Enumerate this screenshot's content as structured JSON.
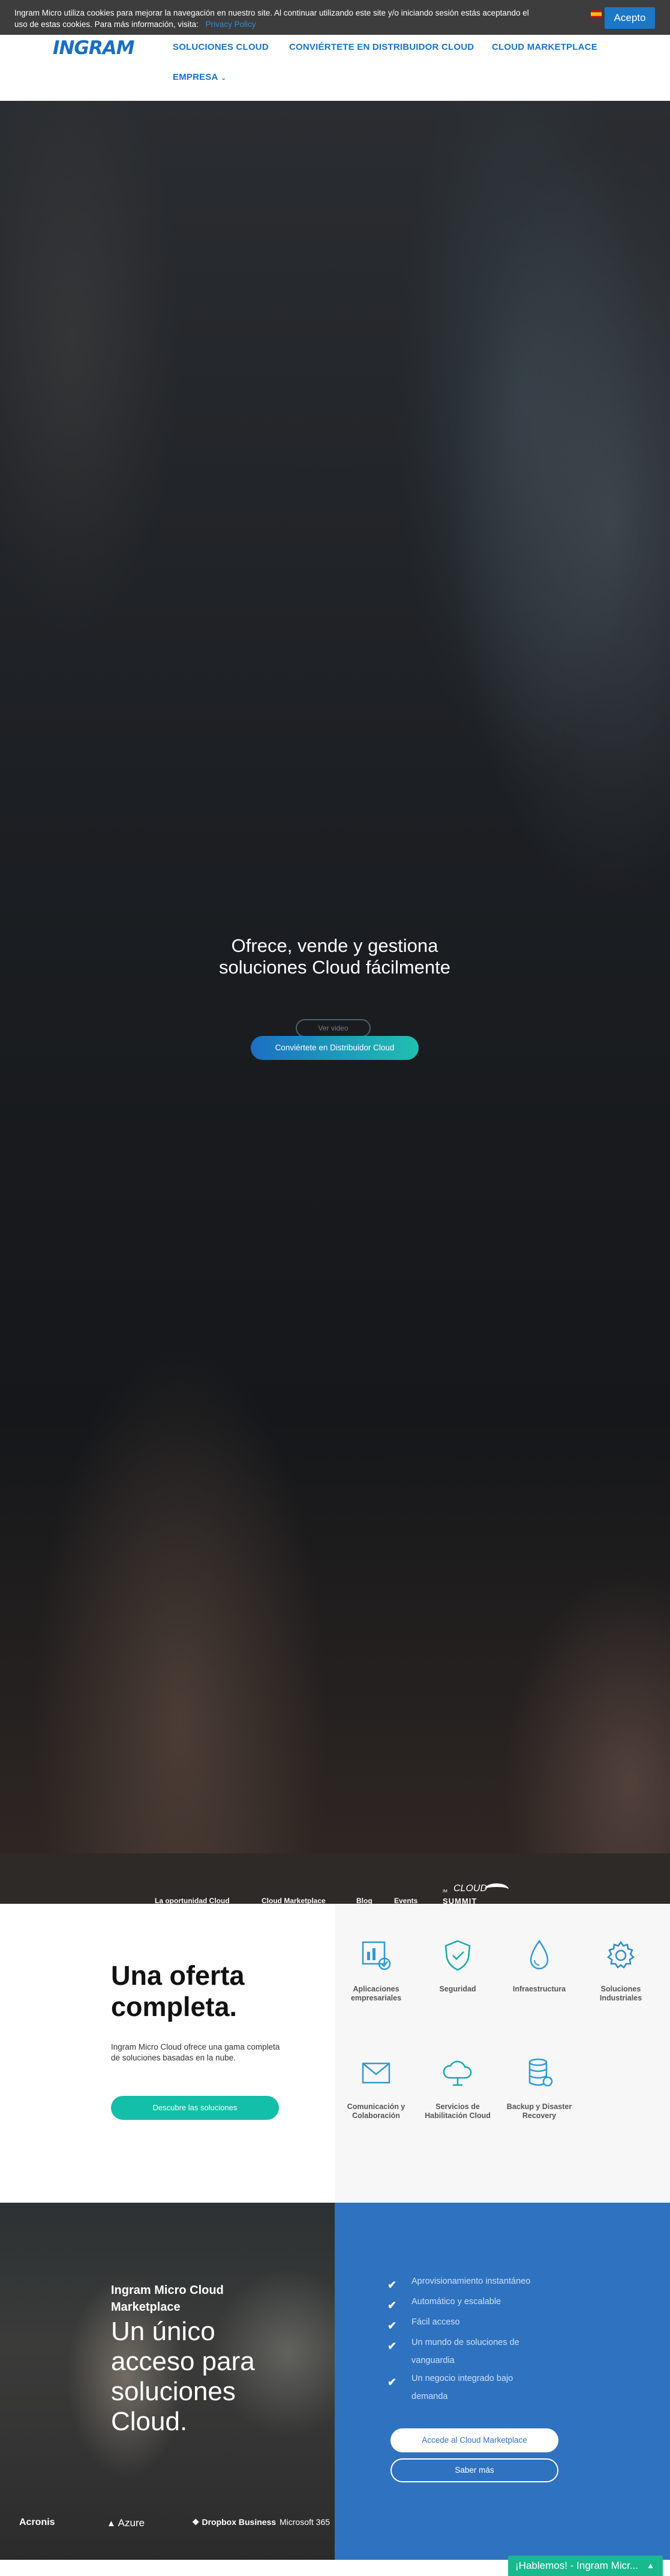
{
  "cookie": {
    "text": "Ingram Micro utiliza cookies para mejorar la navegación en nuestro site. Al continuar utilizando este site y/o iniciando sesión estás aceptando el uso de estas cookies. Para más información, visita:",
    "link": "Privacy Policy",
    "accept": "Acepto"
  },
  "header": {
    "logo": "INGRAM",
    "nav": [
      "SOLUCIONES CLOUD",
      "CONVIÉRTETE EN DISTRIBUIDOR CLOUD",
      "CLOUD MARKETPLACE",
      "EMPRESA"
    ],
    "brand_color": "#1b72c8"
  },
  "hero": {
    "title": "Ofrece, vende y gestiona soluciones Cloud fácilmente",
    "ghost_button": "Ver video",
    "cta": "Conviértete en Distribuidor Cloud"
  },
  "subnav": {
    "links": [
      "La oportunidad Cloud",
      "Cloud Marketplace",
      "Blog",
      "Events"
    ],
    "summit_small": "IM",
    "summit_cloud": "CLOUD",
    "summit_big": "SUMMIT"
  },
  "offer": {
    "title": "Una oferta completa.",
    "description": "Ingram Micro Cloud ofrece una gama completa de soluciones basadas en la nube.",
    "button": "Descubre las soluciones",
    "solutions": [
      {
        "label": "Aplicaciones empresariales",
        "icon": "chart-icon"
      },
      {
        "label": "Seguridad",
        "icon": "shield-icon"
      },
      {
        "label": "Infraestructura",
        "icon": "drop-icon"
      },
      {
        "label": "Soluciones Industriales",
        "icon": "gear-icon"
      },
      {
        "label": "Comunicación y Colaboración",
        "icon": "mail-icon"
      },
      {
        "label": "Servicios de Habilitación Cloud",
        "icon": "cloud-icon"
      },
      {
        "label": "Backup y Disaster Recovery",
        "icon": "database-icon"
      }
    ],
    "accent": "#13bfa8"
  },
  "marketplace": {
    "kicker": "Ingram Micro Cloud Marketplace",
    "title": "Un único acceso para soluciones Cloud.",
    "checks": [
      "Aprovisionamiento instantáneo",
      "Automático y escalable",
      "Fácil acceso",
      "Un mundo de soluciones de vanguardia",
      "Un negocio integrado bajo demanda"
    ],
    "button_primary": "Accede al Cloud Marketplace",
    "button_secondary": "Saber más",
    "panel_color": "#2f72c0"
  },
  "partners": [
    "Acronis",
    "Azure",
    "Dropbox Business",
    "Microsoft 365"
  ],
  "chat": {
    "label": "¡Hablemos! - Ingram Micr..."
  }
}
